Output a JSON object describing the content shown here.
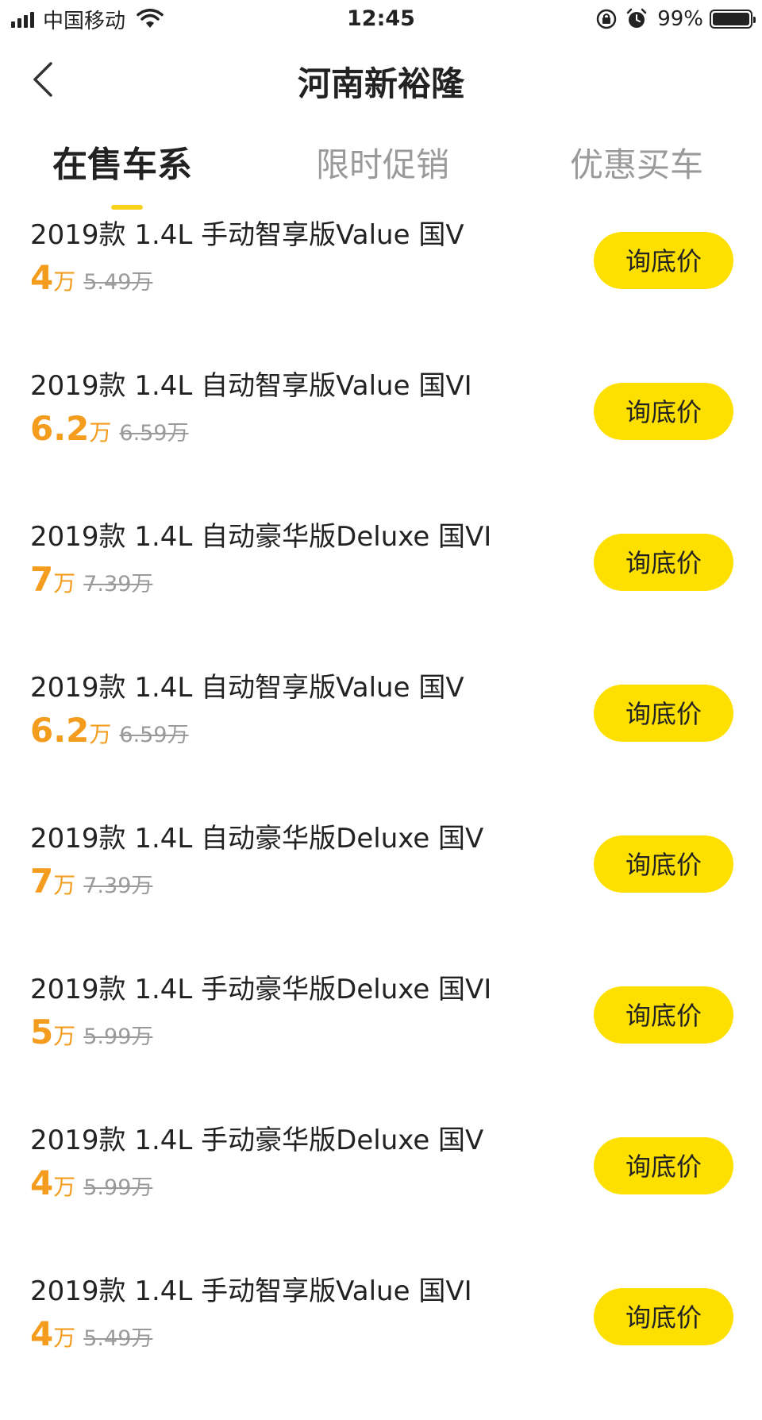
{
  "status_bar": {
    "carrier": "中国移动",
    "time": "12:45",
    "battery": "99%"
  },
  "nav": {
    "title": "河南新裕隆"
  },
  "tabs": [
    {
      "label": "在售车系"
    },
    {
      "label": "限时促销"
    },
    {
      "label": "优惠买车"
    }
  ],
  "cars": [
    {
      "name": "2019款 1.4L 手动智享版Value 国V",
      "price": "4",
      "unit": "万",
      "original": "5.49万",
      "button": "询底价"
    },
    {
      "name": "2019款 1.4L 自动智享版Value 国VI",
      "price": "6.2",
      "unit": "万",
      "original": "6.59万",
      "button": "询底价"
    },
    {
      "name": "2019款 1.4L 自动豪华版Deluxe 国VI",
      "price": "7",
      "unit": "万",
      "original": "7.39万",
      "button": "询底价"
    },
    {
      "name": "2019款 1.4L 自动智享版Value 国V",
      "price": "6.2",
      "unit": "万",
      "original": "6.59万",
      "button": "询底价"
    },
    {
      "name": "2019款 1.4L 自动豪华版Deluxe 国V",
      "price": "7",
      "unit": "万",
      "original": "7.39万",
      "button": "询底价"
    },
    {
      "name": "2019款 1.4L 手动豪华版Deluxe 国VI",
      "price": "5",
      "unit": "万",
      "original": "5.99万",
      "button": "询底价"
    },
    {
      "name": "2019款 1.4L 手动豪华版Deluxe 国V",
      "price": "4",
      "unit": "万",
      "original": "5.99万",
      "button": "询底价"
    },
    {
      "name": "2019款 1.4L 手动智享版Value 国VI",
      "price": "4",
      "unit": "万",
      "original": "5.49万",
      "button": "询底价"
    }
  ],
  "colors": {
    "accent": "#fde000",
    "price": "#f39c1e",
    "muted": "#9a9a9a"
  }
}
